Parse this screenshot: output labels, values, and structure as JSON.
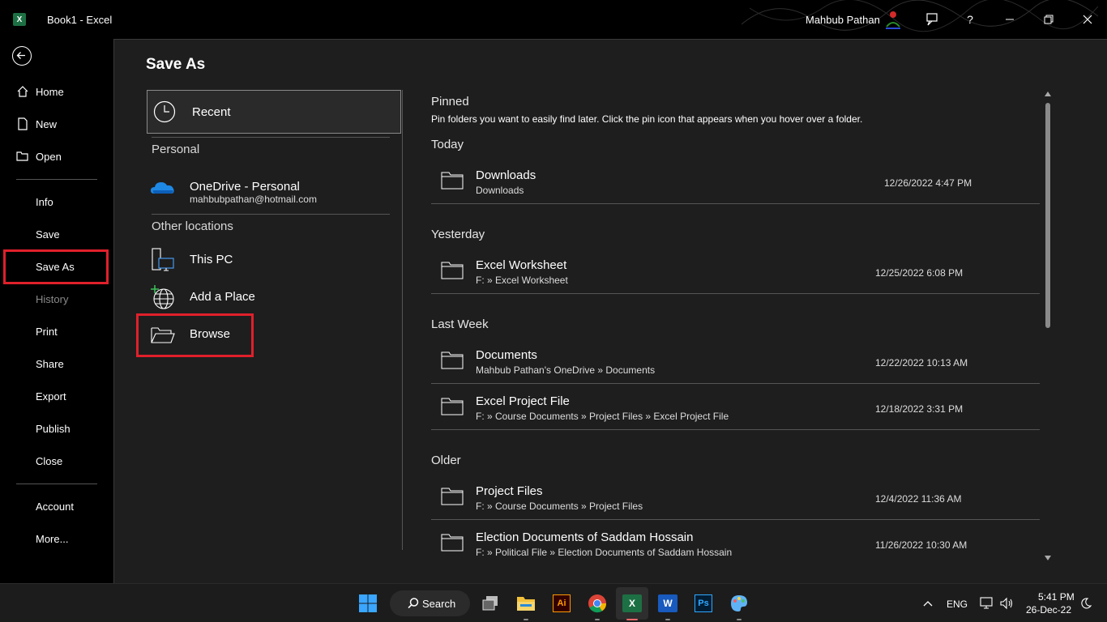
{
  "window": {
    "title": "Book1  -  Excel",
    "app_badge": "X",
    "user_name": "Mahbub Pathan"
  },
  "nav": {
    "items": [
      {
        "label": "Home",
        "icon": "home-icon"
      },
      {
        "label": "New",
        "icon": "new-document-icon"
      },
      {
        "label": "Open",
        "icon": "open-folder-icon"
      },
      {
        "label": "Info"
      },
      {
        "label": "Save"
      },
      {
        "label": "Save As"
      },
      {
        "label": "History"
      },
      {
        "label": "Print"
      },
      {
        "label": "Share"
      },
      {
        "label": "Export"
      },
      {
        "label": "Publish"
      },
      {
        "label": "Close"
      },
      {
        "label": "Account"
      },
      {
        "label": "More..."
      }
    ]
  },
  "page": {
    "title": "Save As"
  },
  "locations": {
    "recent_label": "Recent",
    "personal_header": "Personal",
    "onedrive_label": "OneDrive - Personal",
    "onedrive_email": "mahbubpathan@hotmail.com",
    "other_header": "Other locations",
    "this_pc_label": "This PC",
    "add_place_label": "Add a Place",
    "browse_label": "Browse"
  },
  "recent": {
    "pinned_header": "Pinned",
    "pinned_desc": "Pin folders you want to easily find later. Click the pin icon that appears when you hover over a folder.",
    "groups": [
      {
        "header": "Today"
      },
      {
        "header": "Yesterday"
      },
      {
        "header": "Last Week"
      },
      {
        "header": "Older"
      }
    ],
    "folders": [
      {
        "name": "Downloads",
        "path": "Downloads",
        "date": "12/26/2022 4:47 PM"
      },
      {
        "name": "Excel Worksheet",
        "path": "F: » Excel Worksheet",
        "date": "12/25/2022 6:08 PM"
      },
      {
        "name": "Documents",
        "path": "Mahbub Pathan's OneDrive » Documents",
        "date": "12/22/2022 10:13 AM"
      },
      {
        "name": "Excel Project File",
        "path": "F: » Course Documents » Project Files » Excel Project File",
        "date": "12/18/2022 3:31 PM"
      },
      {
        "name": "Project Files",
        "path": "F: » Course Documents » Project Files",
        "date": "12/4/2022 11:36 AM"
      },
      {
        "name": "Election Documents of Saddam Hossain",
        "path": "F: » Political File » Election Documents of Saddam Hossain",
        "date": "11/26/2022 10:30 AM"
      }
    ]
  },
  "taskbar": {
    "search_label": "Search",
    "illustrator_label": "Ai",
    "excel_label": "X",
    "word_label": "W",
    "photoshop_label": "Ps",
    "lang": "ENG",
    "time": "5:41 PM",
    "date": "26-Dec-22"
  },
  "colors": {
    "highlight_box": "#e0202b",
    "excel_green": "#1d7044",
    "panel_bg": "#1e1e1e"
  }
}
